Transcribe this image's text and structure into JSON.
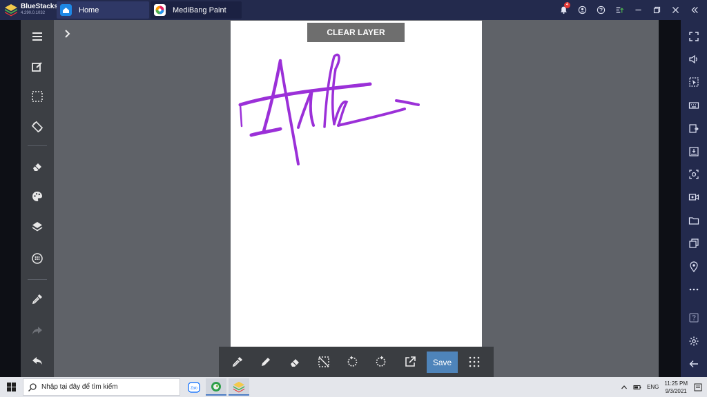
{
  "titlebar": {
    "brand_name": "BlueStacks",
    "version": "4.290.0.1032",
    "tabs": [
      {
        "label": "Home",
        "icon": "home-icon"
      },
      {
        "label": "MediBang Paint",
        "icon": "medibang-icon"
      }
    ],
    "icons": [
      "notification-bell-icon",
      "account-icon",
      "help-icon",
      "update-icon",
      "minimize-icon",
      "restore-icon",
      "close-icon",
      "collapse-sidebar-icon"
    ],
    "notification_count": "4"
  },
  "right_rail": {
    "icons": [
      "fullscreen-icon",
      "volume-icon",
      "pointer-icon",
      "keyboard-icon",
      "install-apk-icon",
      "apk-icon",
      "screenshot-icon",
      "record-icon",
      "folder-icon",
      "multi-instance-icon",
      "location-icon",
      "more-icon",
      "help-icon",
      "settings-icon",
      "back-icon"
    ]
  },
  "left_toolbar": {
    "tools": [
      "menu-icon",
      "edit-icon",
      "selection-icon",
      "rotate-canvas-icon",
      "eraser-icon",
      "color-palette-icon",
      "layers-icon",
      "brush-settings-icon",
      "eyedropper-icon",
      "redo-icon",
      "undo-icon"
    ]
  },
  "canvas": {
    "clear_layer_label": "CLEAR LAYER",
    "drawing_text": "Anh",
    "stroke_color": "#9b30d8"
  },
  "bottom_toolbar": {
    "tools": [
      "eyedropper-icon",
      "pen-icon",
      "eraser-icon",
      "deselect-icon",
      "rotate-left-icon",
      "rotate-right-icon",
      "export-icon",
      "grid-icon"
    ],
    "save_label": "Save"
  },
  "taskbar": {
    "search_placeholder": "Nhập tại đây để tìm kiếm",
    "apps": [
      "zalo-icon",
      "coccoc-icon",
      "bluestacks-icon"
    ],
    "zalo_label": "Zalo",
    "language": "ENG",
    "time": "11:25 PM",
    "date": "9/3/2021"
  },
  "colors": {
    "titlebar_bg": "#232a4d",
    "toolbar_bg": "#3c3f44",
    "workspace_bg": "#5f6268",
    "save_accent": "#4e84ba",
    "stroke": "#9b30d8"
  }
}
